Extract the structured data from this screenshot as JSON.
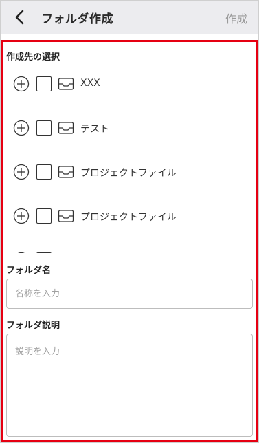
{
  "header": {
    "title": "フォルダ作成",
    "create_label": "作成"
  },
  "destination": {
    "label": "作成先の選択",
    "items": [
      {
        "label": "XXX"
      },
      {
        "label": "テスト"
      },
      {
        "label": "プロジェクトファイル"
      },
      {
        "label": "プロジェクトファイル"
      },
      {
        "label": ""
      }
    ]
  },
  "folder_name": {
    "label": "フォルダ名",
    "placeholder": "名称を入力"
  },
  "folder_description": {
    "label": "フォルダ説明",
    "placeholder": "説明を入力"
  },
  "colors": {
    "header_bg": "#ececef",
    "highlight_border": "#e60012"
  },
  "icons": {
    "back": "chevron-left-icon",
    "expand": "plus-circle-icon",
    "folder": "inbox-tray-icon"
  }
}
